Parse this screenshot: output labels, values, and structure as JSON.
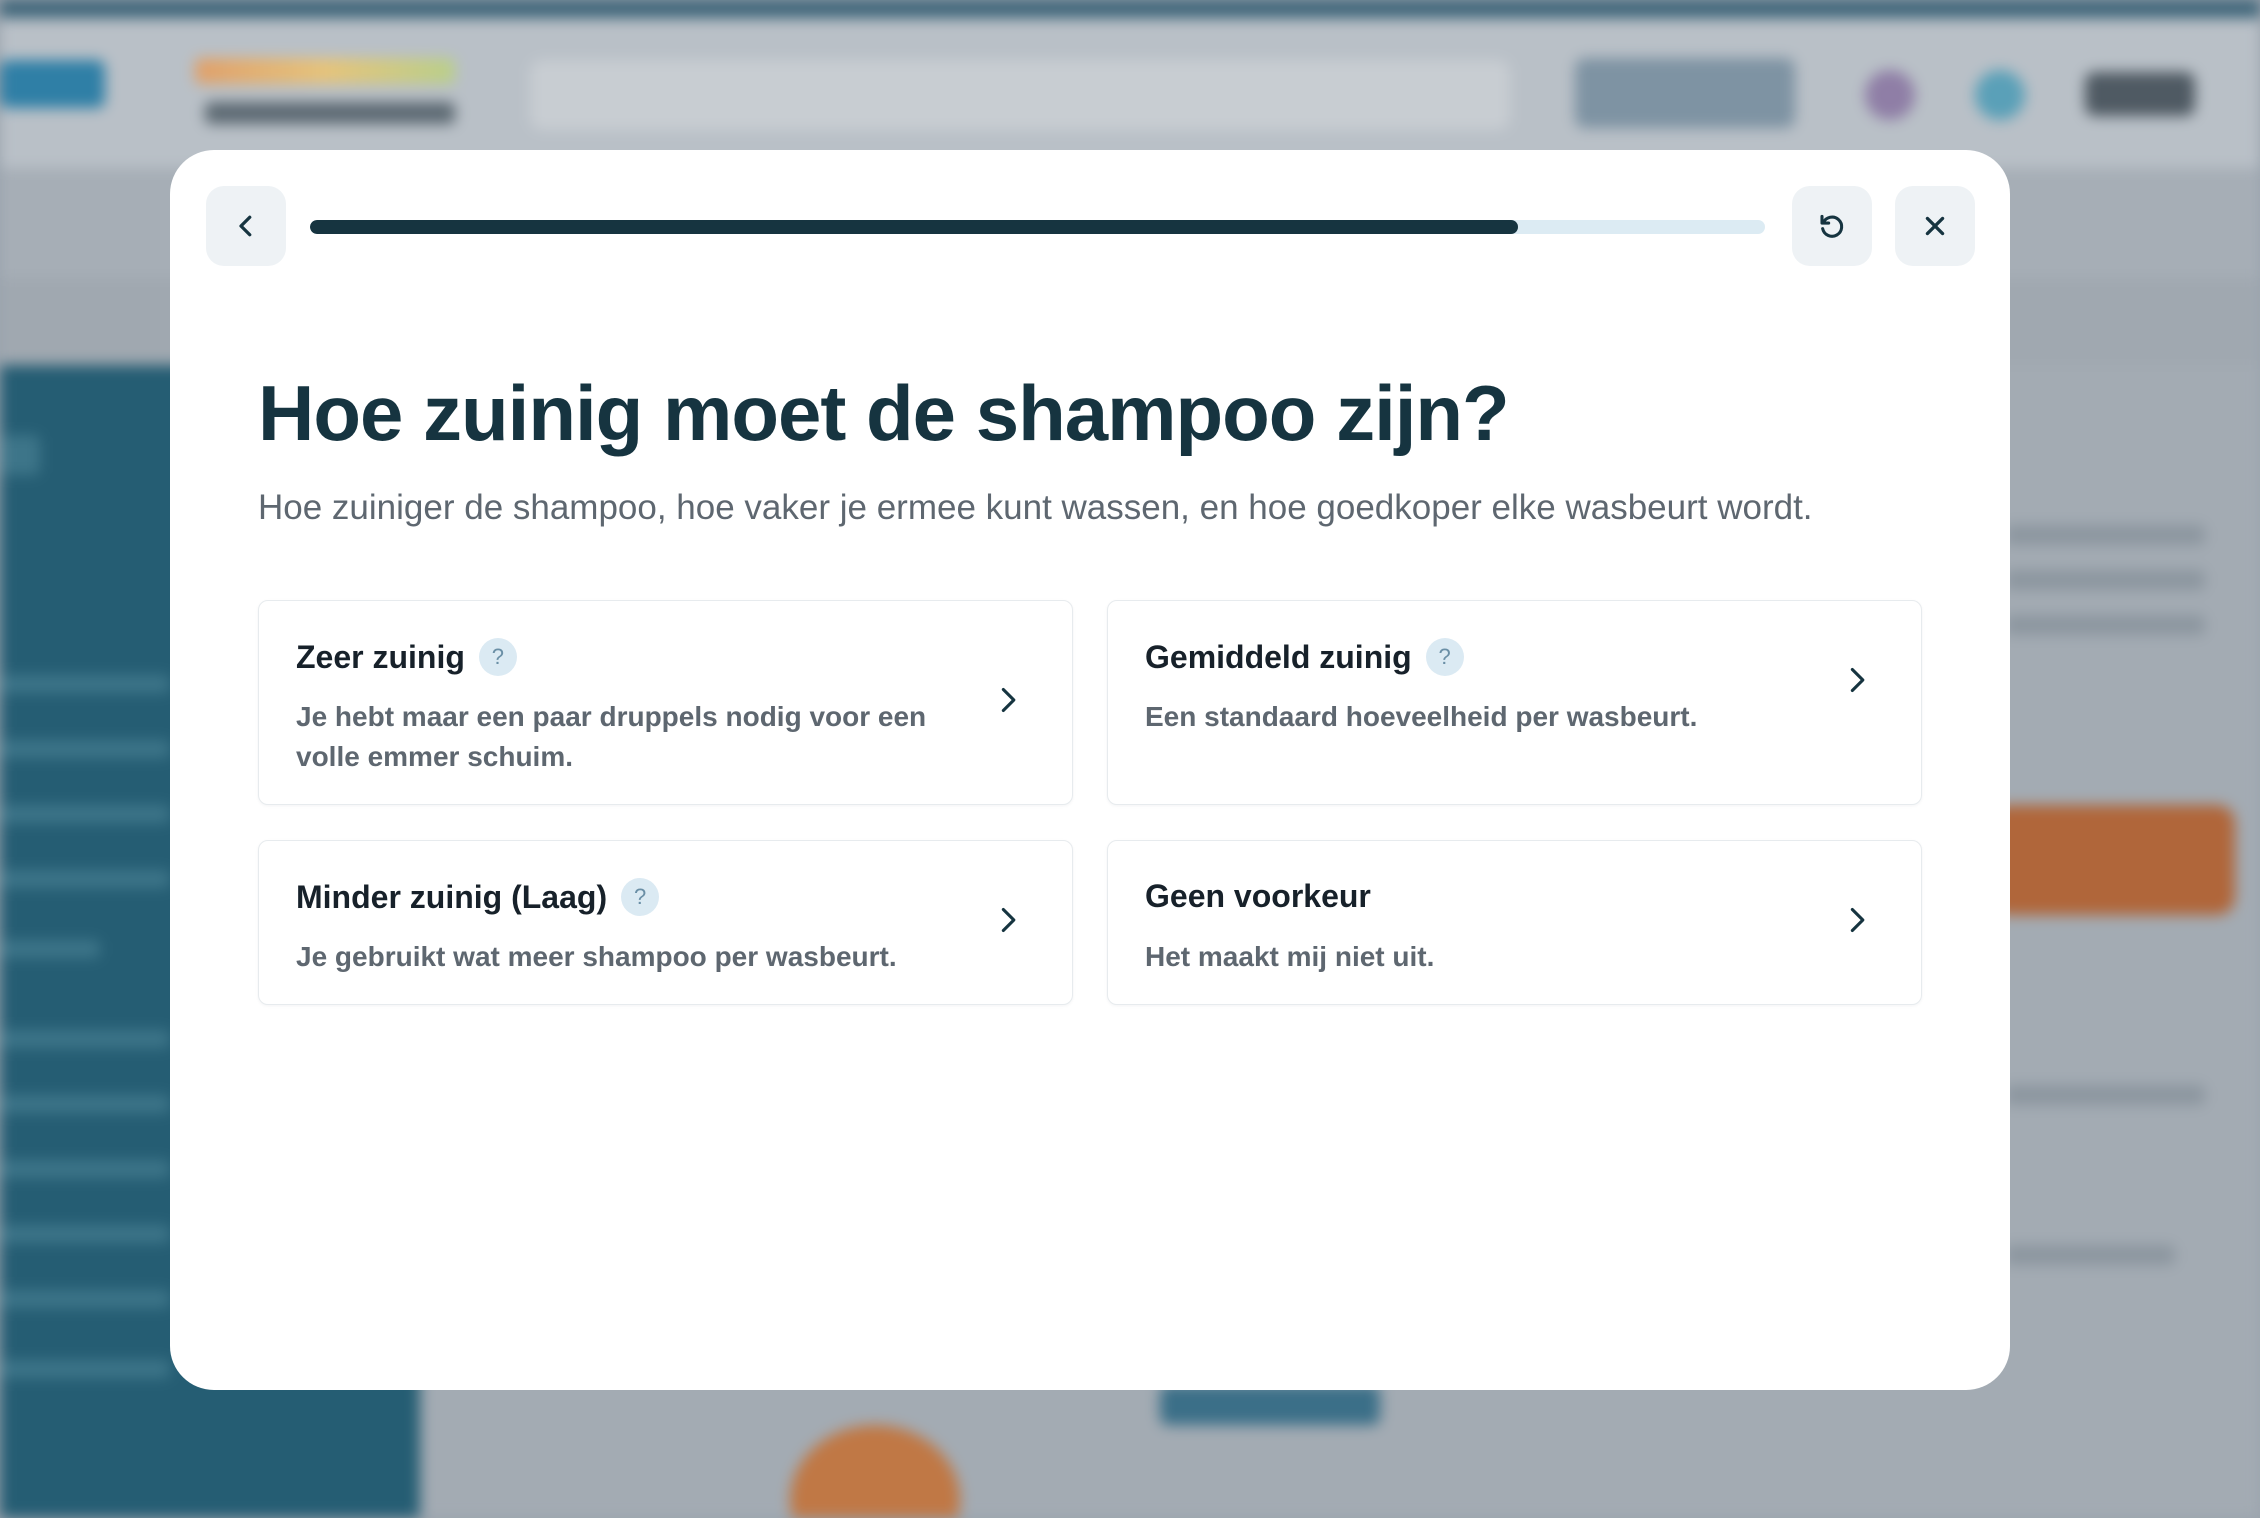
{
  "modal": {
    "progress_fraction": 0.83,
    "title": "Hoe zuinig moet de shampoo zijn?",
    "subtitle": "Hoe zuiniger de shampoo, hoe vaker je ermee kunt wassen, en hoe goedkoper elke wasbeurt wordt.",
    "help_symbol": "?",
    "options": [
      {
        "title": "Zeer zuinig",
        "description": "Je hebt maar een paar druppels nodig voor een volle emmer schuim.",
        "has_help": true
      },
      {
        "title": "Gemiddeld zuinig",
        "description": "Een standaard hoeveelheid per wasbeurt.",
        "has_help": true
      },
      {
        "title": "Minder zuinig (Laag)",
        "description": "Je gebruikt wat meer shampoo per wasbeurt.",
        "has_help": true
      },
      {
        "title": "Geen voorkeur",
        "description": "Het maakt mij niet uit.",
        "has_help": false
      }
    ],
    "icons": {
      "back": "chevron-left-icon",
      "restart": "restart-icon",
      "close": "close-icon",
      "option": "chevron-right-icon"
    },
    "colors": {
      "primary": "#163440",
      "progress_track": "#dcebf3",
      "button_bg": "#eef2f5",
      "help_bg": "#dbeaf3"
    }
  }
}
